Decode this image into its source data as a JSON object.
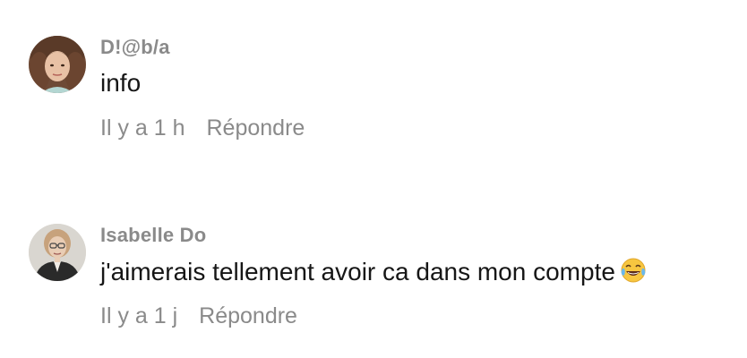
{
  "comments": [
    {
      "username": "D!@b/a",
      "text": "info",
      "time": "Il y a 1 h",
      "reply_label": "Répondre",
      "avatar_icon": "user-avatar-woman-curly-hair"
    },
    {
      "username": "Isabelle Do",
      "text": "j'aimerais tellement avoir ca dans mon compte",
      "emoji_icon": "face-with-tears-of-joy-icon",
      "time": "Il y a 1 j",
      "reply_label": "Répondre",
      "avatar_icon": "user-avatar-woman-glasses"
    }
  ],
  "colors": {
    "username": "#8a8a8a",
    "text": "#161616",
    "meta": "#8a8a8a",
    "background": "#ffffff"
  }
}
